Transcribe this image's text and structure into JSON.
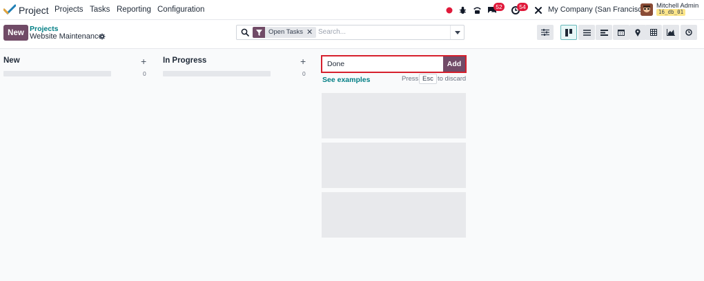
{
  "navbar": {
    "app_name": "Project",
    "menu": [
      "Projects",
      "Tasks",
      "Reporting",
      "Configuration"
    ],
    "messages_badge": "52",
    "activities_badge": "54",
    "company": "My Company (San Francisco)",
    "user_name": "Mitchell Admin",
    "db_name": "16_db_01",
    "colors": {
      "recording_dot": "#e0193a",
      "badge": "#e0193a"
    }
  },
  "control_panel": {
    "new_label": "New",
    "breadcrumb": "Projects",
    "title": "Website Maintenance",
    "search": {
      "facet_label": "Open Tasks",
      "placeholder": "Search..."
    },
    "views": [
      "kanban-icon",
      "list-icon",
      "form-icon",
      "calendar-icon",
      "map-icon",
      "pivot-icon",
      "graph-icon",
      "activity-icon"
    ],
    "active_view": "kanban-icon"
  },
  "kanban": {
    "columns": [
      {
        "title": "New",
        "count": "0"
      },
      {
        "title": "In Progress",
        "count": "0"
      }
    ],
    "quick_create": {
      "value": "Done",
      "add_label": "Add",
      "see_examples": "See examples",
      "hint_press": "Press",
      "hint_key": "Esc",
      "hint_discard": "to discard"
    }
  },
  "colors": {
    "brand": "#714b67",
    "accent": "#017e84",
    "focus_border": "#d61f2c"
  }
}
